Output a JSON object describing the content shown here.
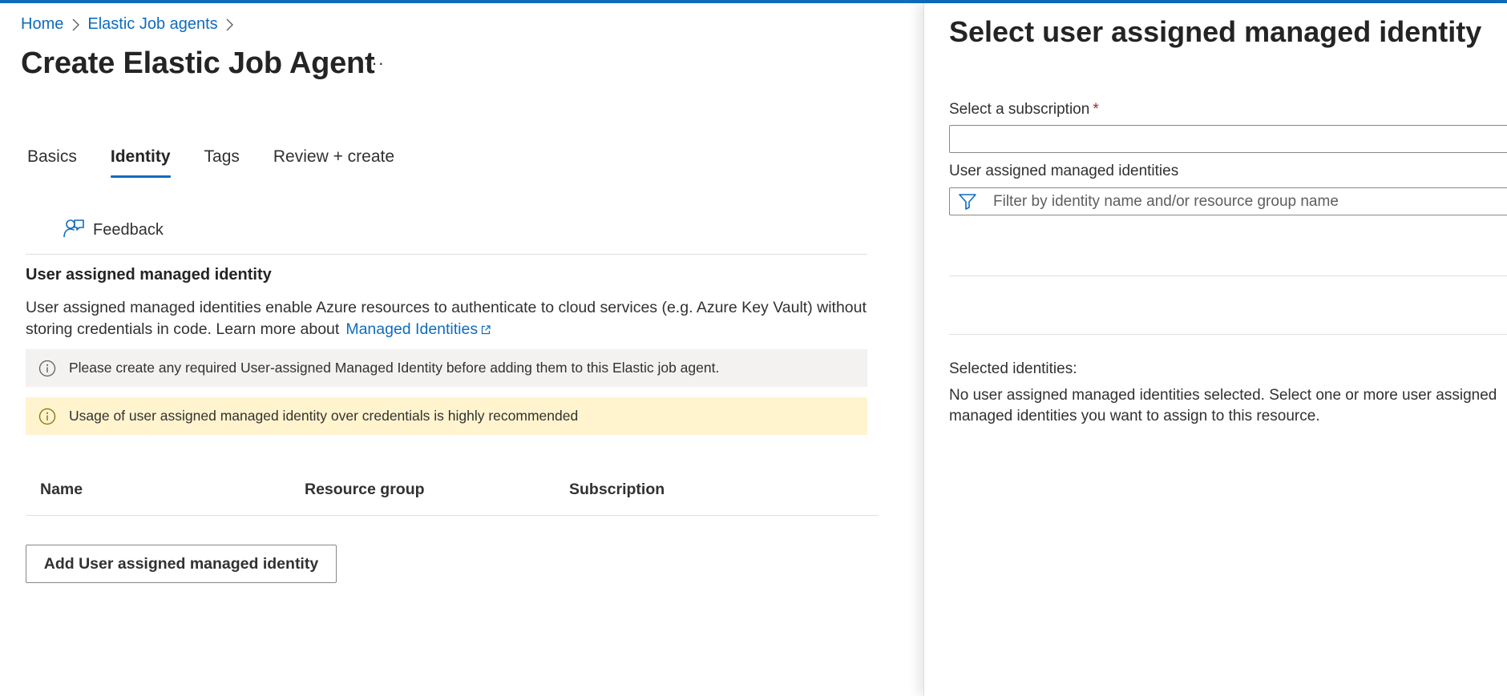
{
  "breadcrumb": {
    "home": "Home",
    "parent": "Elastic Job agents"
  },
  "page": {
    "title": "Create Elastic Job Agent",
    "more": "···"
  },
  "tabs": [
    {
      "label": "Basics"
    },
    {
      "label": "Identity",
      "active": true
    },
    {
      "label": "Tags"
    },
    {
      "label": "Review + create"
    }
  ],
  "toolbar": {
    "feedback": "Feedback"
  },
  "section": {
    "title": "User assigned managed identity",
    "description": "User assigned managed identities enable Azure resources to authenticate to cloud services (e.g. Azure Key Vault) without storing credentials in code. Learn more about",
    "link": "Managed Identities"
  },
  "messages": {
    "info": "Please create any required User-assigned Managed Identity before adding them to this Elastic job agent.",
    "warning": "Usage of user assigned managed identity over credentials is highly recommended"
  },
  "table": {
    "columns": [
      "Name",
      "Resource group",
      "Subscription"
    ]
  },
  "actions": {
    "add": "Add User assigned managed identity"
  },
  "pane": {
    "title": "Select user assigned managed identity",
    "subscription_label": "Select a subscription",
    "required_mark": "*",
    "subscription_value": "",
    "uami_label": "User assigned managed identities",
    "filter_placeholder": "Filter by identity name and/or resource group name",
    "selected_label": "Selected identities:",
    "none_selected": "No user assigned managed identities selected. Select one or more user assigned managed identities you want to assign to this resource."
  },
  "colors": {
    "accent": "#0f6cbd",
    "info_bg": "#f3f2f1",
    "warning_bg": "#fff4ce",
    "required": "#a4262c"
  }
}
